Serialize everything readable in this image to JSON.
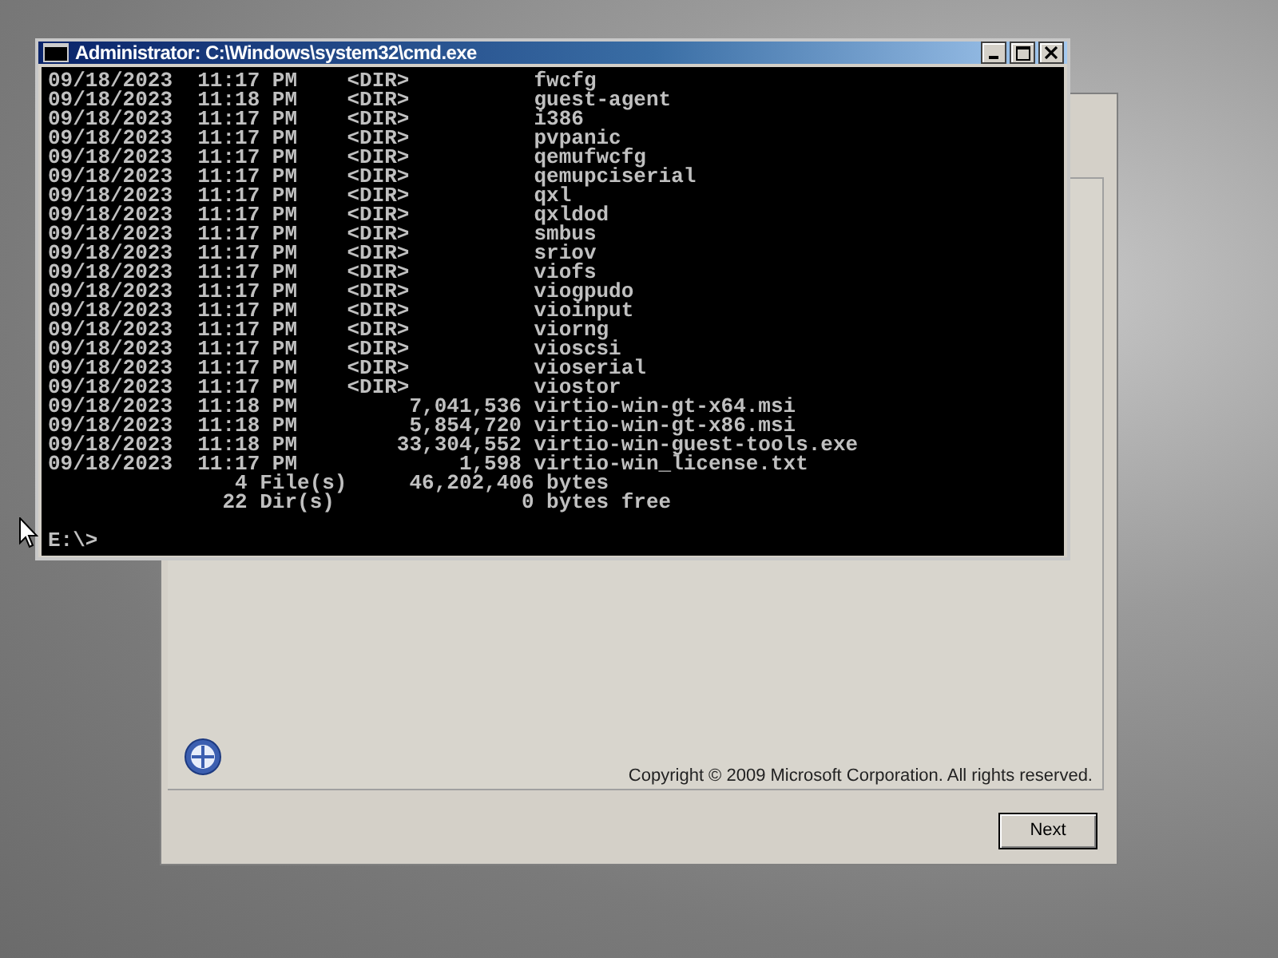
{
  "setup_window": {
    "copyright": "Copyright © 2009 Microsoft Corporation.  All rights reserved.",
    "buttons": [
      {
        "label": "Next"
      }
    ]
  },
  "console_window": {
    "title": "Administrator: C:\\Windows\\system32\\cmd.exe",
    "lines": [
      "09/18/2023  11:17 PM    <DIR>          fwcfg",
      "09/18/2023  11:18 PM    <DIR>          guest-agent",
      "09/18/2023  11:17 PM    <DIR>          i386",
      "09/18/2023  11:17 PM    <DIR>          pvpanic",
      "09/18/2023  11:17 PM    <DIR>          qemufwcfg",
      "09/18/2023  11:17 PM    <DIR>          qemupciserial",
      "09/18/2023  11:17 PM    <DIR>          qxl",
      "09/18/2023  11:17 PM    <DIR>          qxldod",
      "09/18/2023  11:17 PM    <DIR>          smbus",
      "09/18/2023  11:17 PM    <DIR>          sriov",
      "09/18/2023  11:17 PM    <DIR>          viofs",
      "09/18/2023  11:17 PM    <DIR>          viogpudo",
      "09/18/2023  11:17 PM    <DIR>          vioinput",
      "09/18/2023  11:17 PM    <DIR>          viorng",
      "09/18/2023  11:17 PM    <DIR>          vioscsi",
      "09/18/2023  11:17 PM    <DIR>          vioserial",
      "09/18/2023  11:17 PM    <DIR>          viostor",
      "09/18/2023  11:18 PM         7,041,536 virtio-win-gt-x64.msi",
      "09/18/2023  11:18 PM         5,854,720 virtio-win-gt-x86.msi",
      "09/18/2023  11:18 PM        33,304,552 virtio-win-guest-tools.exe",
      "09/18/2023  11:17 PM             1,598 virtio-win_license.txt",
      "               4 File(s)     46,202,406 bytes",
      "              22 Dir(s)               0 bytes free"
    ],
    "prompt": "E:\\>"
  }
}
